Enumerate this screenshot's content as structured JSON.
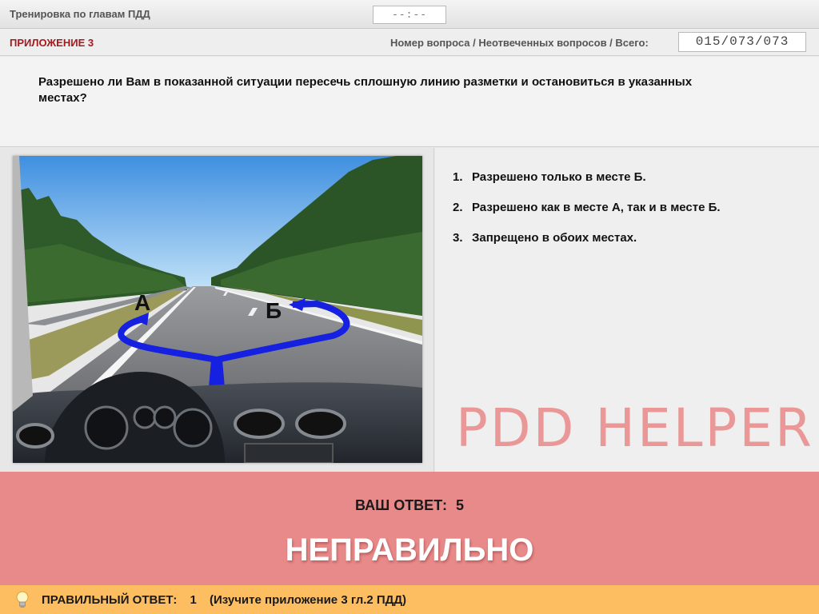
{
  "header": {
    "title": "Тренировка по главам ПДД",
    "timer": "--:--"
  },
  "subheader": {
    "appendix": "ПРИЛОЖЕНИЕ 3",
    "counter_label": "Номер вопроса / Неотвеченных вопросов / Всего:",
    "counter_value": "015/073/073"
  },
  "question": {
    "text": "Разрешено ли Вам в показанной ситуации пересечь сплошную линию разметки и остановиться в указанных местах?",
    "image_labels": {
      "place_a": "А",
      "place_b": "Б"
    }
  },
  "answers": [
    {
      "number": "1.",
      "text": "Разрешено только в месте Б."
    },
    {
      "number": "2.",
      "text": "Разрешено как в месте А, так и в месте Б."
    },
    {
      "number": "3.",
      "text": "Запрещено в обоих местах."
    }
  ],
  "watermark": "PDD HELPER",
  "result": {
    "your_answer_label": "ВАШ  ОТВЕТ:",
    "your_answer_value": "5",
    "verdict": "НЕПРАВИЛЬНО",
    "color": "#e98a8a"
  },
  "correct": {
    "icon": "lightbulb-icon",
    "label": "ПРАВИЛЬНЫЙ ОТВЕТ:",
    "value": "1",
    "hint": "(Изучите приложение 3 гл.2 ПДД)",
    "color": "#fdbe62"
  }
}
